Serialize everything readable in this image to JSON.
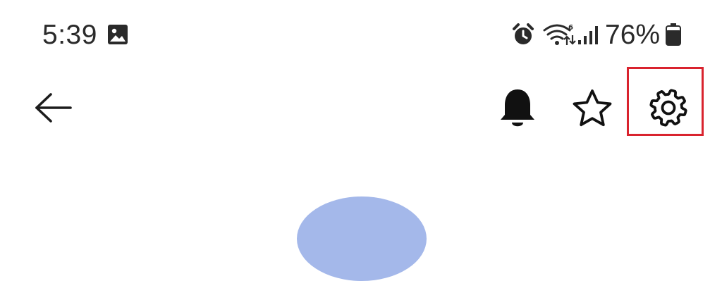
{
  "status_bar": {
    "time": "5:39",
    "battery_percent": "76%",
    "icons": {
      "notification": "gallery-icon",
      "alarm": "alarm-icon",
      "wifi": "wifi-icon",
      "signal": "signal-icon",
      "battery": "battery-icon"
    }
  },
  "app_bar": {
    "back": "back-arrow-icon",
    "actions": [
      "bell-icon",
      "star-icon",
      "gear-icon"
    ],
    "highlighted_action": "gear-icon",
    "highlight_color": "#d9232e"
  },
  "profile": {
    "avatar_color": "#a4b8ea"
  }
}
